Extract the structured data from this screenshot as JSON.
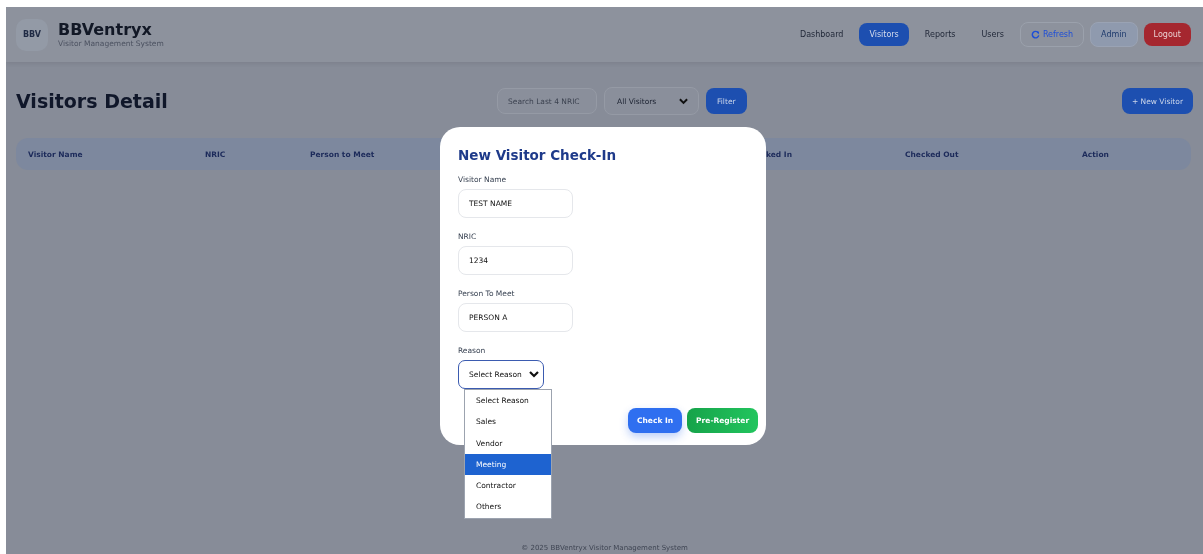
{
  "brand": {
    "logo": "BBV",
    "title": "BBVentryx",
    "subtitle": "Visitor Management System"
  },
  "nav": [
    {
      "label": "Dashboard",
      "selected": false
    },
    {
      "label": "Visitors",
      "selected": true
    },
    {
      "label": "Reports",
      "selected": false
    },
    {
      "label": "Users",
      "selected": false
    }
  ],
  "header_buttons": [
    {
      "kind": "refresh",
      "label": "Refresh"
    },
    {
      "kind": "admin",
      "label": "Admin"
    },
    {
      "kind": "logout",
      "label": "Logout"
    }
  ],
  "page_title": "Visitors Detail",
  "search": {
    "placeholder": "Search Last 4 NRIC"
  },
  "filter_select": {
    "value": "All Visitors"
  },
  "filter_button": "Filter",
  "new_button": "+ New Visitor",
  "table": {
    "columns": [
      "Visitor Name",
      "NRIC",
      "Person to Meet",
      "ked In",
      "Checked Out",
      "Action"
    ]
  },
  "modal": {
    "title": "New Visitor Check-In",
    "fields": [
      {
        "label": "Visitor Name",
        "value": "TEST NAME"
      },
      {
        "label": "NRIC",
        "value": "1234"
      },
      {
        "label": "Person To Meet",
        "value": "PERSON A"
      }
    ],
    "reason": {
      "label": "Reason",
      "value": "Select Reason",
      "expanded": true,
      "options": [
        {
          "label": "Select Reason",
          "highlighted": false
        },
        {
          "label": "Sales",
          "highlighted": false
        },
        {
          "label": "Vendor",
          "highlighted": false
        },
        {
          "label": "Meeting",
          "highlighted": true
        },
        {
          "label": "Contractor",
          "highlighted": false
        },
        {
          "label": "Others",
          "highlighted": false
        }
      ]
    },
    "buttons": [
      {
        "kind": "checkin",
        "label": "Check In"
      },
      {
        "kind": "preregister",
        "label": "Pre-Register"
      }
    ]
  },
  "footer": "© 2025 BBVentryx Visitor Management System"
}
